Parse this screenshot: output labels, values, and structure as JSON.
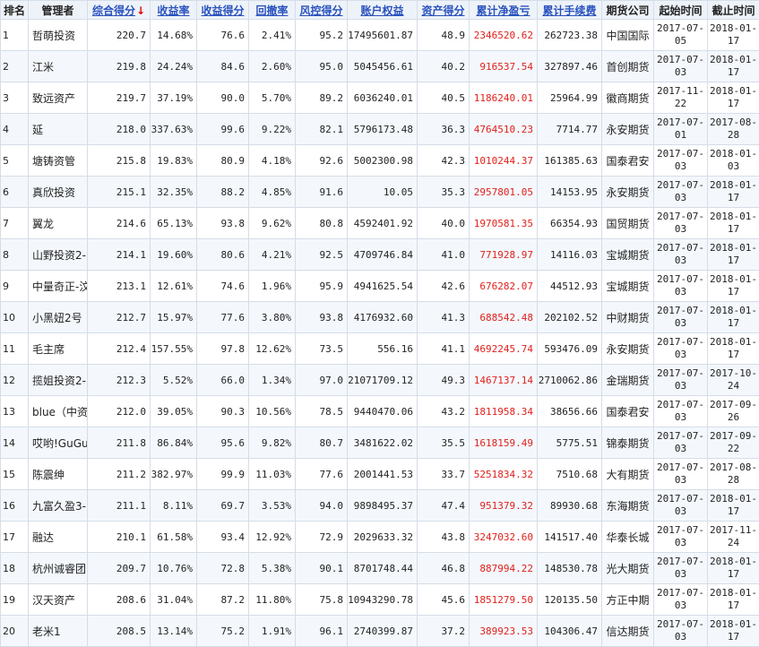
{
  "headers": {
    "rank": "排名",
    "manager": "管理者",
    "composite": "综合得分",
    "sort_arrow": "↓",
    "return_rate": "收益率",
    "return_score": "收益得分",
    "drawdown": "回撤率",
    "risk_score": "风控得分",
    "equity": "账户权益",
    "asset_score": "资产得分",
    "net_profit": "累计净盈亏",
    "fees": "累计手续费",
    "company": "期货公司",
    "start": "起始时间",
    "end": "截止时间"
  },
  "colors": {
    "accent_link": "#2a52be",
    "profit_red": "#e0201c",
    "sort_arrow": "#e00000"
  },
  "rows": [
    {
      "rank": "1",
      "manager": "哲萌投资",
      "composite": "220.7",
      "return_rate": "14.68%",
      "return_score": "76.6",
      "drawdown": "2.41%",
      "risk_score": "95.2",
      "equity": "17495601.87",
      "asset_score": "48.9",
      "net_profit": "2346520.62",
      "fees": "262723.38",
      "company": "中国国际",
      "start": "2017-07-05",
      "end": "2018-01-17"
    },
    {
      "rank": "2",
      "manager": "江米",
      "composite": "219.8",
      "return_rate": "24.24%",
      "return_score": "84.6",
      "drawdown": "2.60%",
      "risk_score": "95.0",
      "equity": "5045456.61",
      "asset_score": "40.2",
      "net_profit": "916537.54",
      "fees": "327897.46",
      "company": "首创期货",
      "start": "2017-07-03",
      "end": "2018-01-17"
    },
    {
      "rank": "3",
      "manager": "致远资产",
      "composite": "219.7",
      "return_rate": "37.19%",
      "return_score": "90.0",
      "drawdown": "5.70%",
      "risk_score": "89.2",
      "equity": "6036240.01",
      "asset_score": "40.5",
      "net_profit": "1186240.01",
      "fees": "25964.99",
      "company": "徽商期货",
      "start": "2017-11-22",
      "end": "2018-01-17"
    },
    {
      "rank": "4",
      "manager": "延",
      "composite": "218.0",
      "return_rate": "337.63%",
      "return_score": "99.6",
      "drawdown": "9.22%",
      "risk_score": "82.1",
      "equity": "5796173.48",
      "asset_score": "36.3",
      "net_profit": "4764510.23",
      "fees": "7714.77",
      "company": "永安期货",
      "start": "2017-07-01",
      "end": "2017-08-28"
    },
    {
      "rank": "5",
      "manager": "塘铸资管",
      "composite": "215.8",
      "return_rate": "19.83%",
      "return_score": "80.9",
      "drawdown": "4.18%",
      "risk_score": "92.6",
      "equity": "5002300.98",
      "asset_score": "42.3",
      "net_profit": "1010244.37",
      "fees": "161385.63",
      "company": "国泰君安",
      "start": "2017-07-03",
      "end": "2018-01-03"
    },
    {
      "rank": "6",
      "manager": "真欣投资",
      "composite": "215.1",
      "return_rate": "32.35%",
      "return_score": "88.2",
      "drawdown": "4.85%",
      "risk_score": "91.6",
      "equity": "10.05",
      "asset_score": "35.3",
      "net_profit": "2957801.05",
      "fees": "14153.95",
      "company": "永安期货",
      "start": "2017-07-03",
      "end": "2018-01-17"
    },
    {
      "rank": "7",
      "manager": "翼龙",
      "composite": "214.6",
      "return_rate": "65.13%",
      "return_score": "93.8",
      "drawdown": "9.62%",
      "risk_score": "80.8",
      "equity": "4592401.92",
      "asset_score": "40.0",
      "net_profit": "1970581.35",
      "fees": "66354.93",
      "company": "国贸期货",
      "start": "2017-07-03",
      "end": "2018-01-17"
    },
    {
      "rank": "8",
      "manager": "山野投资2-",
      "composite": "214.1",
      "return_rate": "19.60%",
      "return_score": "80.6",
      "drawdown": "4.21%",
      "risk_score": "92.5",
      "equity": "4709746.84",
      "asset_score": "41.0",
      "net_profit": "771928.97",
      "fees": "14116.03",
      "company": "宝城期货",
      "start": "2017-07-03",
      "end": "2018-01-17"
    },
    {
      "rank": "9",
      "manager": "中量奇正-汶",
      "composite": "213.1",
      "return_rate": "12.61%",
      "return_score": "74.6",
      "drawdown": "1.96%",
      "risk_score": "95.9",
      "equity": "4941625.54",
      "asset_score": "42.6",
      "net_profit": "676282.07",
      "fees": "44512.93",
      "company": "宝城期货",
      "start": "2017-07-03",
      "end": "2018-01-17"
    },
    {
      "rank": "10",
      "manager": "小黑妞2号",
      "composite": "212.7",
      "return_rate": "15.97%",
      "return_score": "77.6",
      "drawdown": "3.80%",
      "risk_score": "93.8",
      "equity": "4176932.60",
      "asset_score": "41.3",
      "net_profit": "688542.48",
      "fees": "202102.52",
      "company": "中财期货",
      "start": "2017-07-03",
      "end": "2018-01-17"
    },
    {
      "rank": "11",
      "manager": "毛主席",
      "composite": "212.4",
      "return_rate": "157.55%",
      "return_score": "97.8",
      "drawdown": "12.62%",
      "risk_score": "73.5",
      "equity": "556.16",
      "asset_score": "41.1",
      "net_profit": "4692245.74",
      "fees": "593476.09",
      "company": "永安期货",
      "start": "2017-07-03",
      "end": "2018-01-17"
    },
    {
      "rank": "12",
      "manager": "揽姐投资2-",
      "composite": "212.3",
      "return_rate": "5.52%",
      "return_score": "66.0",
      "drawdown": "1.34%",
      "risk_score": "97.0",
      "equity": "21071709.12",
      "asset_score": "49.3",
      "net_profit": "1467137.14",
      "fees": "2710062.86",
      "company": "金瑞期货",
      "start": "2017-07-03",
      "end": "2017-10-24"
    },
    {
      "rank": "13",
      "manager": "blue（中资",
      "composite": "212.0",
      "return_rate": "39.05%",
      "return_score": "90.3",
      "drawdown": "10.56%",
      "risk_score": "78.5",
      "equity": "9440470.06",
      "asset_score": "43.2",
      "net_profit": "1811958.34",
      "fees": "38656.66",
      "company": "国泰君安",
      "start": "2017-07-03",
      "end": "2017-09-26"
    },
    {
      "rank": "14",
      "manager": "哎哟!GuGu",
      "composite": "211.8",
      "return_rate": "86.84%",
      "return_score": "95.6",
      "drawdown": "9.82%",
      "risk_score": "80.7",
      "equity": "3481622.02",
      "asset_score": "35.5",
      "net_profit": "1618159.49",
      "fees": "5775.51",
      "company": "锦泰期货",
      "start": "2017-07-03",
      "end": "2017-09-22"
    },
    {
      "rank": "15",
      "manager": "陈震绅",
      "composite": "211.2",
      "return_rate": "382.97%",
      "return_score": "99.9",
      "drawdown": "11.03%",
      "risk_score": "77.6",
      "equity": "2001441.53",
      "asset_score": "33.7",
      "net_profit": "5251834.32",
      "fees": "7510.68",
      "company": "大有期货",
      "start": "2017-07-03",
      "end": "2017-08-28"
    },
    {
      "rank": "16",
      "manager": "九富久盈3-",
      "composite": "211.1",
      "return_rate": "8.11%",
      "return_score": "69.7",
      "drawdown": "3.53%",
      "risk_score": "94.0",
      "equity": "9898495.37",
      "asset_score": "47.4",
      "net_profit": "951379.32",
      "fees": "89930.68",
      "company": "东海期货",
      "start": "2017-07-03",
      "end": "2018-01-17"
    },
    {
      "rank": "17",
      "manager": "融达",
      "composite": "210.1",
      "return_rate": "61.58%",
      "return_score": "93.4",
      "drawdown": "12.92%",
      "risk_score": "72.9",
      "equity": "2029633.32",
      "asset_score": "43.8",
      "net_profit": "3247032.60",
      "fees": "141517.40",
      "company": "华泰长城",
      "start": "2017-07-03",
      "end": "2017-11-24"
    },
    {
      "rank": "18",
      "manager": "杭州诚睿团",
      "composite": "209.7",
      "return_rate": "10.76%",
      "return_score": "72.8",
      "drawdown": "5.38%",
      "risk_score": "90.1",
      "equity": "8701748.44",
      "asset_score": "46.8",
      "net_profit": "887994.22",
      "fees": "148530.78",
      "company": "光大期货",
      "start": "2017-07-03",
      "end": "2018-01-17"
    },
    {
      "rank": "19",
      "manager": "汉天资产",
      "composite": "208.6",
      "return_rate": "31.04%",
      "return_score": "87.2",
      "drawdown": "11.80%",
      "risk_score": "75.8",
      "equity": "10943290.78",
      "asset_score": "45.6",
      "net_profit": "1851279.50",
      "fees": "120135.50",
      "company": "方正中期",
      "start": "2017-07-03",
      "end": "2018-01-17"
    },
    {
      "rank": "20",
      "manager": "老米1",
      "composite": "208.5",
      "return_rate": "13.14%",
      "return_score": "75.2",
      "drawdown": "1.91%",
      "risk_score": "96.1",
      "equity": "2740399.87",
      "asset_score": "37.2",
      "net_profit": "389923.53",
      "fees": "104306.47",
      "company": "信达期货",
      "start": "2017-07-03",
      "end": "2018-01-17"
    }
  ]
}
